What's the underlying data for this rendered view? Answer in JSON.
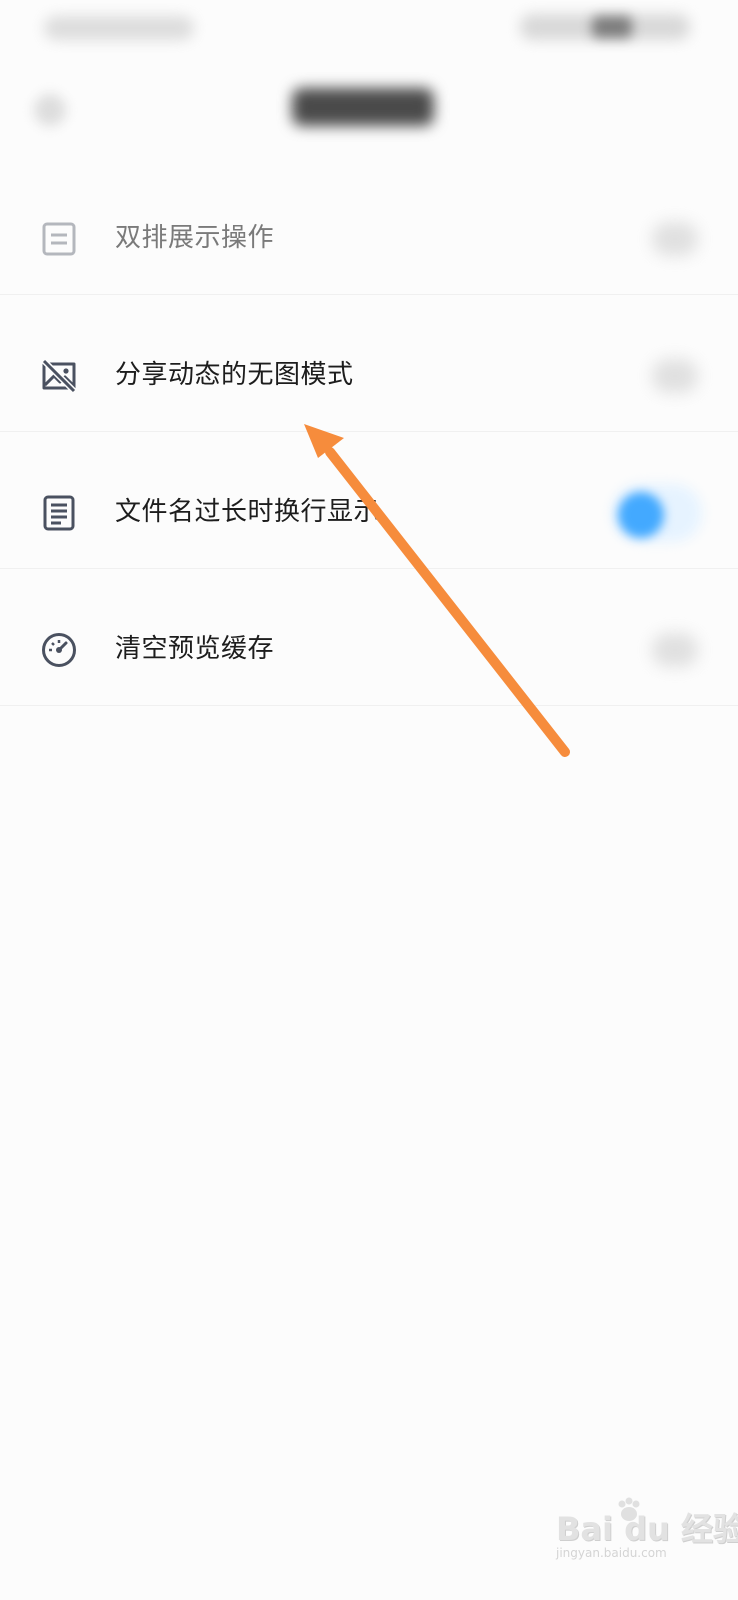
{
  "settings": {
    "items": [
      {
        "label": "双排展示操作",
        "icon": "list-doc-icon",
        "state": "faded"
      },
      {
        "label": "分享动态的无图模式",
        "icon": "no-image-icon"
      },
      {
        "label": "文件名过长时换行显示",
        "icon": "document-lines-icon",
        "toggle": "on"
      },
      {
        "label": "清空预览缓存",
        "icon": "speedometer-icon"
      }
    ]
  },
  "colors": {
    "toggle_on": "#43a9ff",
    "annotation_arrow": "#f68c3c",
    "label": "#1d1d1d"
  },
  "watermark": {
    "logo": "Bai du 经验",
    "url": "jingyan.baidu.com"
  }
}
